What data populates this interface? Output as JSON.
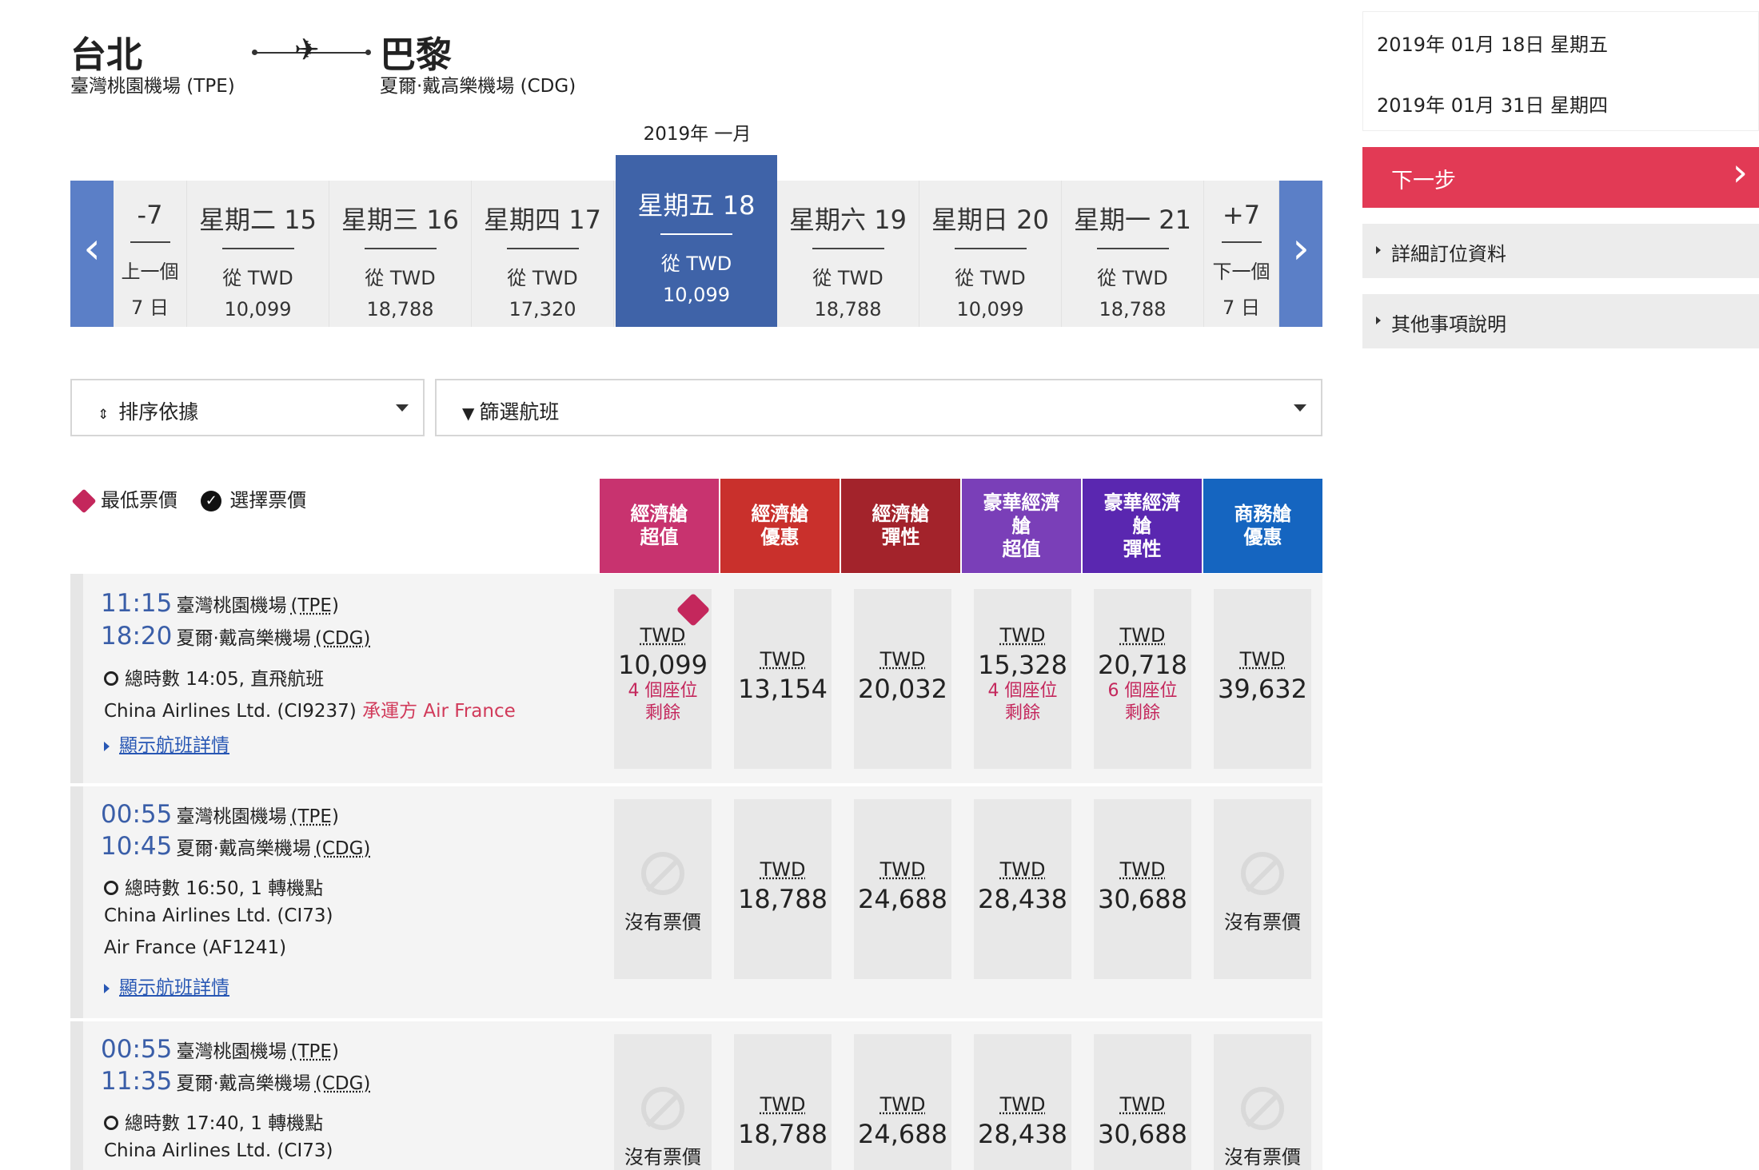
{
  "route": {
    "origin_city": "台北",
    "origin_airport": "臺灣桃園機場 (TPE)",
    "dest_city": "巴黎",
    "dest_airport": "夏爾·戴高樂機場 (CDG)"
  },
  "month_label": "2019年 一月",
  "date_strip": {
    "prev_arrow": "‹",
    "next_arrow": "›",
    "cells": [
      {
        "day": "-7",
        "line1": "上一個",
        "line2": "7 日"
      },
      {
        "day": "星期二 15",
        "line1": "從 TWD",
        "line2": "10,099"
      },
      {
        "day": "星期三 16",
        "line1": "從 TWD",
        "line2": "18,788"
      },
      {
        "day": "星期四 17",
        "line1": "從 TWD",
        "line2": "17,320"
      },
      {
        "day": "星期五 18",
        "line1": "從 TWD",
        "line2": "10,099"
      },
      {
        "day": "星期六 19",
        "line1": "從 TWD",
        "line2": "18,788"
      },
      {
        "day": "星期日 20",
        "line1": "從 TWD",
        "line2": "10,099"
      },
      {
        "day": "星期一 21",
        "line1": "從 TWD",
        "line2": "18,788"
      },
      {
        "day": "+7",
        "line1": "下一個",
        "line2": "7 日"
      }
    ]
  },
  "sort_label": "排序依據",
  "filter_label": "篩選航班",
  "legend": {
    "lowest": "最低票價",
    "selected": "選擇票價"
  },
  "fare_headers": [
    {
      "label": "經濟艙\n超值",
      "color": "#c8336f"
    },
    {
      "label": "經濟艙\n優惠",
      "color": "#c9302c"
    },
    {
      "label": "經濟艙\n彈性",
      "color": "#a3232b"
    },
    {
      "label": "豪華經濟\n艙\n超值",
      "color": "#7a3fb8"
    },
    {
      "label": "豪華經濟\n艙\n彈性",
      "color": "#5a27b0"
    },
    {
      "label": "商務艙\n優惠",
      "color": "#1565c0"
    }
  ],
  "flights": [
    {
      "dep_time": "11:15",
      "dep_apt": "臺灣桃園機場",
      "dep_code": "(TPE)",
      "arr_time": "18:20",
      "arr_apt": "夏爾·戴高樂機場",
      "arr_code": "(CDG)",
      "duration": "總時數 14:05, 直飛航班",
      "carrier1": "China Airlines Ltd. (CI9237)",
      "operated": "承運方 Air France",
      "carrier2": "",
      "details": "顯示航班詳情",
      "fares": [
        {
          "cur": "TWD",
          "amt": "10,099",
          "seats1": "4 個座位",
          "seats2": "剩餘",
          "lowest": true
        },
        {
          "cur": "TWD",
          "amt": "13,154"
        },
        {
          "cur": "TWD",
          "amt": "20,032"
        },
        {
          "cur": "TWD",
          "amt": "15,328",
          "seats1": "4 個座位",
          "seats2": "剩餘"
        },
        {
          "cur": "TWD",
          "amt": "20,718",
          "seats1": "6 個座位",
          "seats2": "剩餘"
        },
        {
          "cur": "TWD",
          "amt": "39,632"
        }
      ]
    },
    {
      "dep_time": "00:55",
      "dep_apt": "臺灣桃園機場",
      "dep_code": "(TPE)",
      "arr_time": "10:45",
      "arr_apt": "夏爾·戴高樂機場",
      "arr_code": "(CDG)",
      "duration": "總時數 16:50, 1 轉機點",
      "carrier1": "China Airlines Ltd. (CI73)",
      "operated": "",
      "carrier2": "Air France (AF1241)",
      "details": "顯示航班詳情",
      "fares": [
        {
          "na": "沒有票價"
        },
        {
          "cur": "TWD",
          "amt": "18,788"
        },
        {
          "cur": "TWD",
          "amt": "24,688"
        },
        {
          "cur": "TWD",
          "amt": "28,438"
        },
        {
          "cur": "TWD",
          "amt": "30,688"
        },
        {
          "na": "沒有票價"
        }
      ]
    },
    {
      "dep_time": "00:55",
      "dep_apt": "臺灣桃園機場",
      "dep_code": "(TPE)",
      "arr_time": "11:35",
      "arr_apt": "夏爾·戴高樂機場",
      "arr_code": "(CDG)",
      "duration": "總時數 17:40, 1 轉機點",
      "carrier1": "China Airlines Ltd. (CI73)",
      "operated": "",
      "carrier2": "",
      "details": "",
      "fares": [
        {
          "na": "沒有票價"
        },
        {
          "cur": "TWD",
          "amt": "18,788"
        },
        {
          "cur": "TWD",
          "amt": "24,688"
        },
        {
          "cur": "TWD",
          "amt": "28,438"
        },
        {
          "cur": "TWD",
          "amt": "30,688"
        },
        {
          "na": "沒有票價"
        }
      ]
    }
  ],
  "sidebar": {
    "depart_date": "2019年 01月 18日 星期五",
    "return_date": "2019年 01月 31日 星期四",
    "next_label": "下一步",
    "next_chevron": "›",
    "acc1": "詳細訂位資料",
    "acc2": "其他事項說明"
  }
}
